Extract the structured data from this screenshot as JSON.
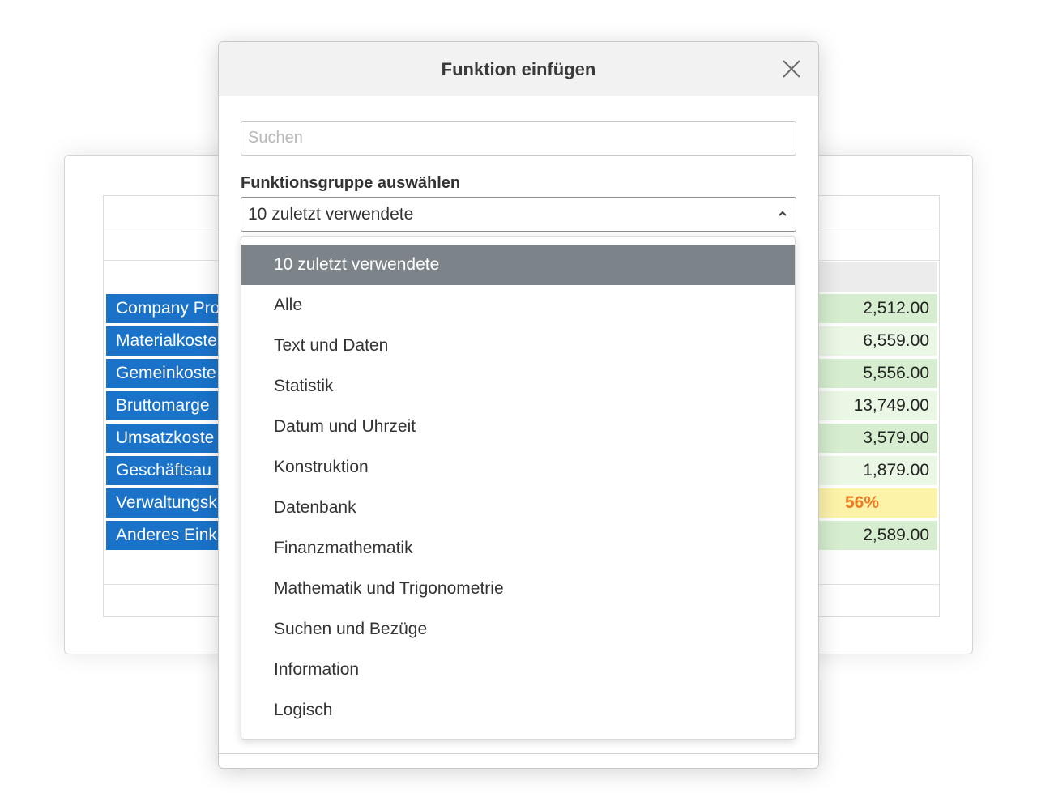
{
  "dialog": {
    "title": "Funktion einfügen",
    "search_placeholder": "Suchen",
    "group_label": "Funktionsgruppe auswählen",
    "selected_group": "10 zuletzt verwendete"
  },
  "dropdown": {
    "items": [
      "10 zuletzt verwendete",
      "Alle",
      "Text und Daten",
      "Statistik",
      "Datum und Uhrzeit",
      "Konstruktion",
      "Datenbank",
      "Finanzmathematik",
      "Mathematik und Trigonometrie",
      "Suchen und Bezüge",
      "Information",
      "Logisch"
    ]
  },
  "sheet": {
    "labels": [
      "Company Pro",
      "Materialkoste",
      "Gemeinkoste",
      "Bruttomarge",
      "Umsatzkoste",
      "Geschäftsau",
      "Verwaltungsk",
      "Anderes Eink"
    ],
    "values": [
      "2,512.00",
      "6,559.00",
      "5,556.00",
      "13,749.00",
      "3,579.00",
      "1,879.00",
      "56%",
      "2,589.00"
    ]
  },
  "colors": {
    "label_bg": "#1a73c9",
    "value_dark": "#d6eecf",
    "value_light": "#eaf7e4",
    "warn_bg": "#fdf3a8",
    "warn_text": "#f07a23",
    "selected_item": "#7c8389"
  },
  "icons": {
    "close": "close-icon",
    "chevron": "chevron-up-icon"
  }
}
